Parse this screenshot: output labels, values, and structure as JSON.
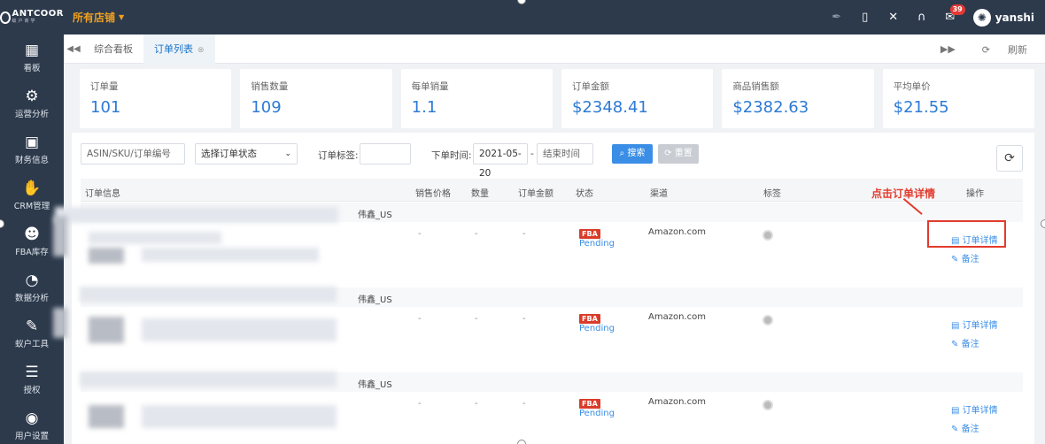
{
  "brand": {
    "name": "ANTCOOR",
    "sub": "蚁户商学"
  },
  "store_selector": {
    "label": "所有店铺"
  },
  "topbar": {
    "badge_count": "39",
    "username": "yanshi"
  },
  "sidebar": {
    "items": [
      {
        "label": "看板",
        "icon": "dashboard-icon",
        "glyph": "▦"
      },
      {
        "label": "运营分析",
        "icon": "network-icon",
        "glyph": "⚙"
      },
      {
        "label": "财务信息",
        "icon": "money-icon",
        "glyph": "▣"
      },
      {
        "label": "CRM管理",
        "icon": "handshake-icon",
        "glyph": "✋"
      },
      {
        "label": "FBA库存",
        "icon": "people-icon",
        "glyph": "☻"
      },
      {
        "label": "数据分析",
        "icon": "pie-chart-icon",
        "glyph": "◔"
      },
      {
        "label": "蚁户工具",
        "icon": "tools-icon",
        "glyph": "✎"
      },
      {
        "label": "授权",
        "icon": "sliders-icon",
        "glyph": "☰"
      },
      {
        "label": "用户设置",
        "icon": "user-icon",
        "glyph": "◉"
      }
    ]
  },
  "tabs": [
    {
      "label": "综合看板"
    },
    {
      "label": "订单列表"
    }
  ],
  "tab_refresh": "刷新",
  "stats": [
    {
      "label": "订单量",
      "value": "101"
    },
    {
      "label": "销售数量",
      "value": "109"
    },
    {
      "label": "每单销量",
      "value": "1.1"
    },
    {
      "label": "订单金额",
      "value": "$2348.41"
    },
    {
      "label": "商品销售额",
      "value": "$2382.63"
    },
    {
      "label": "平均单价",
      "value": "$21.55"
    }
  ],
  "filter": {
    "search_placeholder": "ASIN/SKU/订单编号",
    "status_select": "选择订单状态",
    "tag_label": "订单标签:",
    "time_label": "下单时间:",
    "start_date": "2021-05-20",
    "date_sep": "-",
    "end_placeholder": "结束时间",
    "search_btn": "搜索",
    "reset_btn": "重置"
  },
  "table": {
    "headers": [
      "订单信息",
      "销售价格",
      "数量",
      "订单金额",
      "状态",
      "渠道",
      "标签",
      "操作"
    ]
  },
  "orders": [
    {
      "shop": "伟鑫_US",
      "price": "-",
      "qty": "-",
      "amount": "-",
      "fba": "FBA",
      "status": "Pending",
      "channel": "Amazon.com",
      "detail": "订单详情",
      "note": "备注"
    },
    {
      "shop": "伟鑫_US",
      "price": "-",
      "qty": "-",
      "amount": "-",
      "fba": "FBA",
      "status": "Pending",
      "channel": "Amazon.com",
      "detail": "订单详情",
      "note": "备注"
    },
    {
      "shop": "伟鑫_US",
      "price": "-",
      "qty": "-",
      "amount": "-",
      "fba": "FBA",
      "status": "Pending",
      "channel": "Amazon.com",
      "detail": "订单详情",
      "note": "备注"
    }
  ],
  "annotation": {
    "text": "点击订单详情",
    "color": "#e23b2c"
  },
  "colors": {
    "topbar": "#2c3a4c",
    "accent": "#3a8ee6",
    "store": "#f0a020"
  }
}
